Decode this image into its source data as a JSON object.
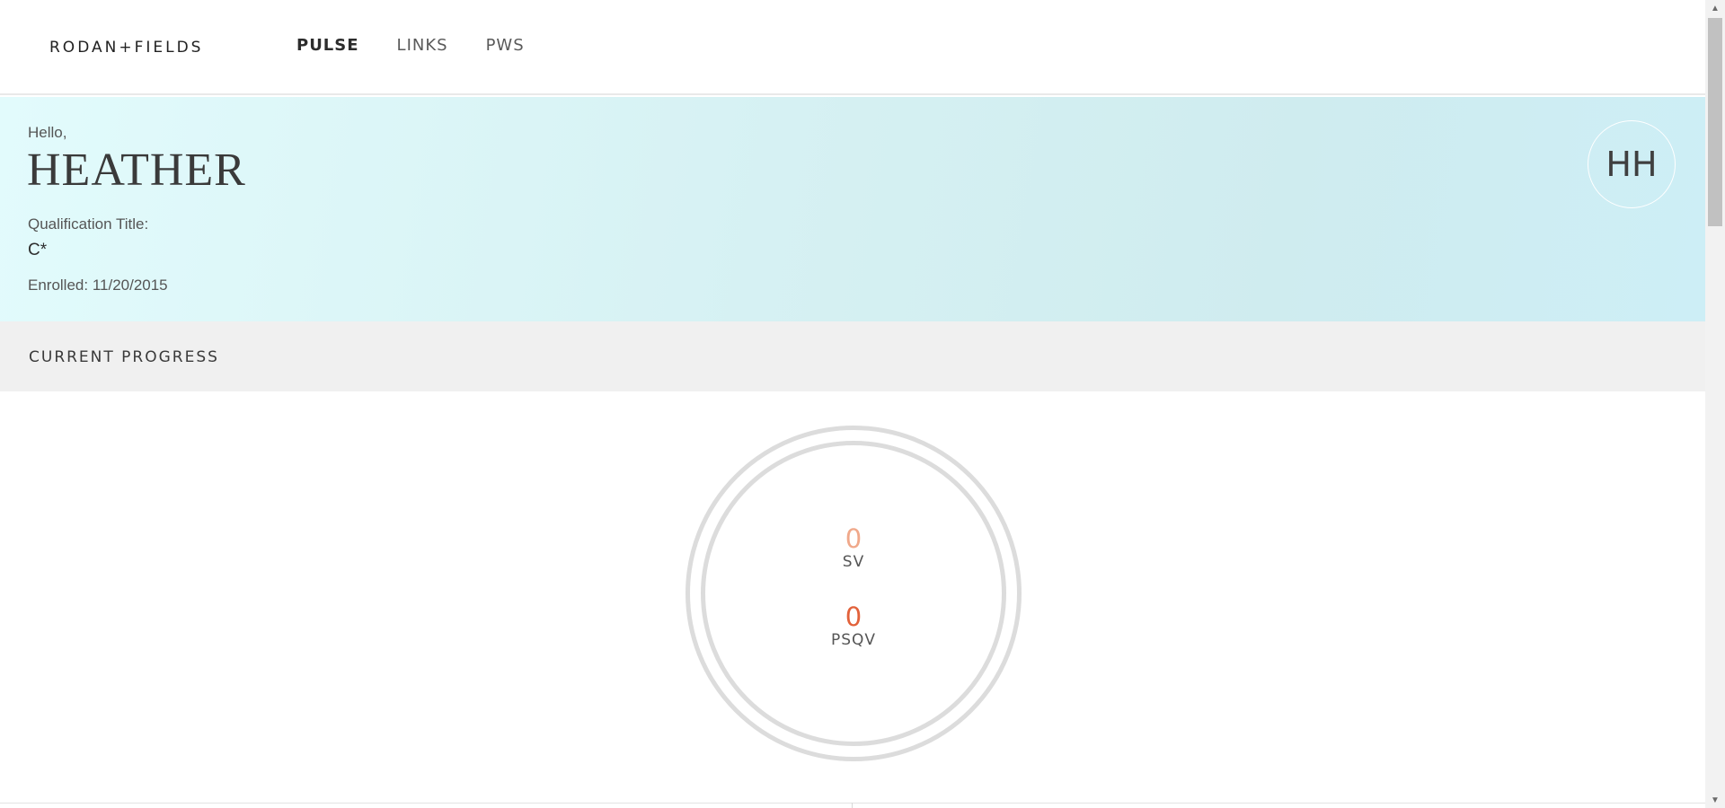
{
  "header": {
    "logo": "RODAN+FIELDS",
    "nav": [
      {
        "label": "PULSE",
        "active": true
      },
      {
        "label": "LINKS",
        "active": false
      },
      {
        "label": "PWS",
        "active": false
      }
    ]
  },
  "hero": {
    "greeting": "Hello,",
    "name": "HEATHER",
    "qualification_label": "Qualification Title:",
    "qualification_value": "C*",
    "enrolled": "Enrolled: 11/20/2015",
    "avatar_initials": "HH"
  },
  "progress": {
    "title": "CURRENT PROGRESS",
    "stats": [
      {
        "value": "0",
        "label": "SV",
        "color": "#f0a88a"
      },
      {
        "value": "0",
        "label": "PSQV",
        "color": "#e2613a"
      }
    ]
  },
  "colors": {
    "hero_gradient_start": "#e2fbfc",
    "hero_gradient_end": "#cdeef6",
    "ring": "#dcdcdc",
    "progress_band": "#f0f0f0"
  },
  "scrollbar": {
    "up_icon": "triangle-up-icon",
    "down_icon": "triangle-down-icon"
  }
}
